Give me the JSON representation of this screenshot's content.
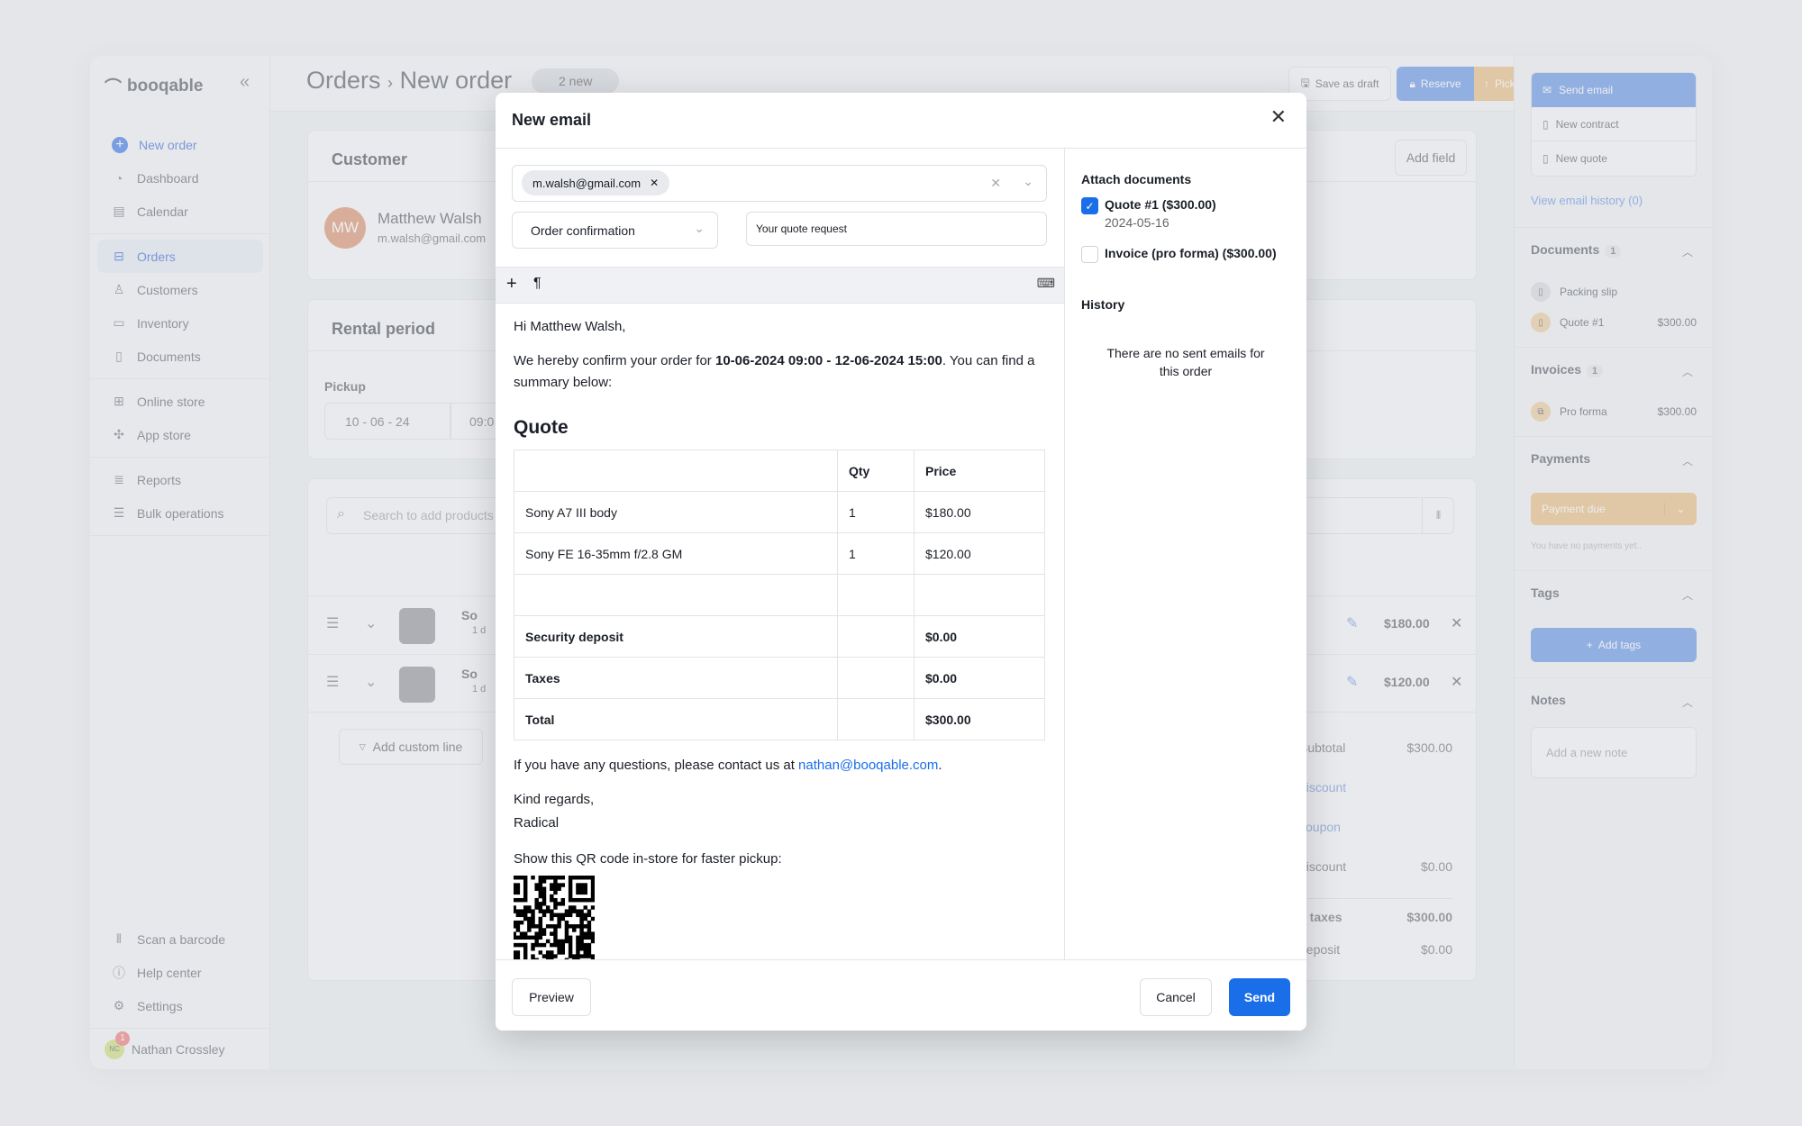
{
  "app": {
    "logo": "booqable"
  },
  "sidebar": {
    "new_order": "New order",
    "items": [
      {
        "label": "Dashboard",
        "icon": "dashboard-icon"
      },
      {
        "label": "Calendar",
        "icon": "calendar-icon"
      },
      {
        "label": "Orders",
        "icon": "inbox-icon",
        "active": true
      },
      {
        "label": "Customers",
        "icon": "user-icon"
      },
      {
        "label": "Inventory",
        "icon": "box-icon"
      },
      {
        "label": "Documents",
        "icon": "document-icon"
      },
      {
        "label": "Online store",
        "icon": "store-icon"
      },
      {
        "label": "App store",
        "icon": "puzzle-icon"
      },
      {
        "label": "Reports",
        "icon": "chart-icon"
      },
      {
        "label": "Bulk operations",
        "icon": "bulk-icon"
      }
    ],
    "bottom": [
      {
        "label": "Scan a barcode"
      },
      {
        "label": "Help center"
      },
      {
        "label": "Settings"
      }
    ],
    "user": {
      "name": "Nathan Crossley",
      "initials": "NC",
      "notifications": "1"
    }
  },
  "header": {
    "crumb_root": "Orders",
    "crumb_current": "New order",
    "badge": "2 new",
    "save_draft": "Save as draft",
    "reserve": "Reserve",
    "pickup": "Pickup",
    "more": "···"
  },
  "customer": {
    "title": "Customer",
    "initials": "MW",
    "name": "Matthew Walsh",
    "email": "m.walsh@gmail.com",
    "add_field": "Add field"
  },
  "rental": {
    "title": "Rental period",
    "pickup_label": "Pickup",
    "pickup_date": "10 - 06 - 24",
    "pickup_time": "09:0"
  },
  "products": {
    "search_placeholder": "Search to add products",
    "lines": [
      {
        "name": "So",
        "sub": "1 d",
        "price": "$180.00"
      },
      {
        "name": "So",
        "sub": "1 d",
        "price": "$120.00"
      }
    ],
    "add_custom": "Add custom line"
  },
  "totals": [
    {
      "label": "Subtotal",
      "value": "$300.00"
    },
    {
      "label": "discount",
      "value": "",
      "link": true
    },
    {
      "label": "coupon",
      "value": "",
      "link": true
    },
    {
      "label": "discount",
      "value": "$0.00"
    },
    {
      "label": "l. taxes",
      "value": "$300.00",
      "bold": true
    },
    {
      "label": "deposit",
      "value": "$0.00"
    }
  ],
  "right_panel": {
    "actions": [
      "Send email",
      "New contract",
      "New quote"
    ],
    "history_link": "View email history (0)",
    "documents": {
      "title": "Documents",
      "count": "1",
      "items": [
        {
          "name": "Packing slip",
          "amount": ""
        },
        {
          "name": "Quote #1",
          "amount": "$300.00"
        }
      ]
    },
    "invoices": {
      "title": "Invoices",
      "count": "1",
      "items": [
        {
          "name": "Pro forma",
          "amount": "$300.00"
        }
      ]
    },
    "payments": {
      "title": "Payments",
      "button": "Payment due",
      "empty": "You have no payments yet.."
    },
    "tags": {
      "title": "Tags",
      "button": "Add tags"
    },
    "notes": {
      "title": "Notes",
      "placeholder": "Add a new note"
    }
  },
  "modal": {
    "title": "New email",
    "recipient": "m.walsh@gmail.com",
    "template": "Order confirmation",
    "subject": "Your quote request",
    "body": {
      "greeting": "Hi Matthew Walsh,",
      "confirm_pre": "We hereby confirm your order for ",
      "confirm_dates": "10-06-2024 09:00 - 12-06-2024 15:00",
      "confirm_post": ". You can find a summary below:",
      "quote_heading": "Quote",
      "table_headers": [
        "",
        "Qty",
        "Price"
      ],
      "rows": [
        [
          "Sony A7 III body",
          "1",
          "$180.00"
        ],
        [
          "Sony FE 16-35mm f/2.8 GM",
          "1",
          "$120.00"
        ],
        [
          "",
          "",
          ""
        ]
      ],
      "summary": [
        [
          "Security deposit",
          "",
          "$0.00"
        ],
        [
          "Taxes",
          "",
          "$0.00"
        ],
        [
          "Total",
          "",
          "$300.00"
        ]
      ],
      "questions_pre": "If you have any questions, please contact us at ",
      "contact_email": "nathan@booqable.com",
      "questions_post": ".",
      "regards": "Kind regards,",
      "signature": "Radical",
      "qr_text": "Show this QR code in-store for faster pickup:"
    },
    "attach_title": "Attach documents",
    "attachments": [
      {
        "label": "Quote #1 ($300.00)",
        "date": "2024-05-16",
        "checked": true
      },
      {
        "label": "Invoice (pro forma) ($300.00)",
        "date": "",
        "checked": false
      }
    ],
    "history_title": "History",
    "history_empty": "There are no sent emails for this order",
    "preview": "Preview",
    "cancel": "Cancel",
    "send": "Send"
  },
  "colors": {
    "primary": "#1a6fe8",
    "orange": "#e8a656",
    "avatar": "#d98a65"
  }
}
